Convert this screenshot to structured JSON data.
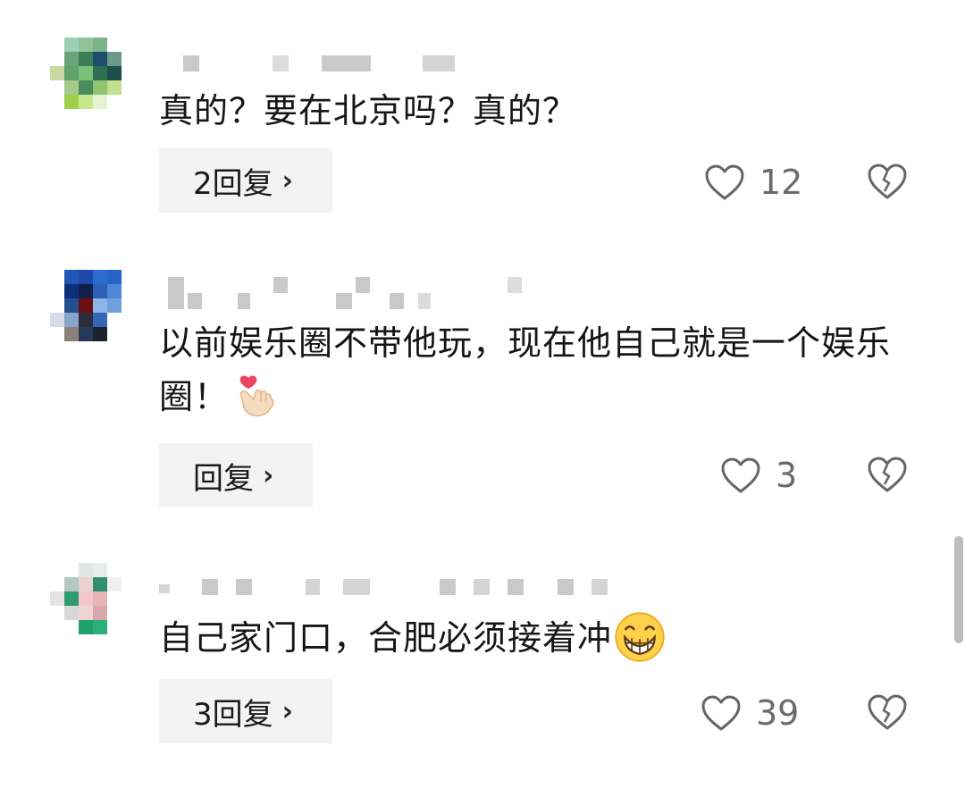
{
  "comments": [
    {
      "text": "真的？要在北京吗？真的？",
      "reply_label": "2回复",
      "like_count": "12",
      "emoji": ""
    },
    {
      "text": "以前娱乐圈不带他玩，现在他自己就是一个娱乐圈！",
      "reply_label": "回复",
      "like_count": "3",
      "emoji": "finger-heart-emoji"
    },
    {
      "text": "自己家门口，合肥必须接着冲",
      "reply_label": "3回复",
      "like_count": "39",
      "emoji": "grinning-emoji"
    }
  ],
  "icons": {
    "like": "heart-outline-icon",
    "dislike": "broken-heart-icon",
    "reply_arrow": "chevron-right-icon"
  },
  "colors": {
    "text": "#161616",
    "count": "#6a6a6a",
    "reply_bg": "#f3f3f3"
  }
}
